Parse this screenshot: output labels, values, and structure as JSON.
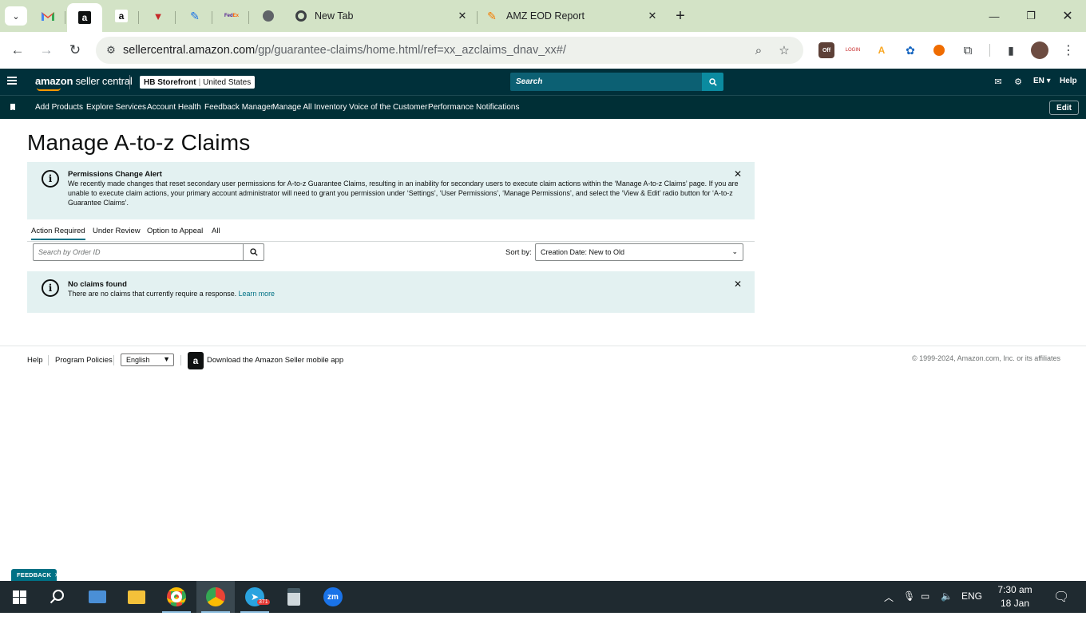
{
  "browser": {
    "tabs": [
      {
        "label": "New Tab",
        "icon": "chrome-icon"
      },
      {
        "label": "AMZ EOD Report",
        "icon": "sheets-icon"
      }
    ],
    "url_host": "sellercentral.amazon.com",
    "url_path": "/gp/guarantee-claims/home.html/ref=xx_azclaims_dnav_xx#/",
    "extensions": [
      "coupon-off-icon",
      "login-icon",
      "scout-icon",
      "extension-blue-icon",
      "extension-orange-icon",
      "puzzle-icon"
    ]
  },
  "header": {
    "logo_brand": "amazon",
    "logo_product": "seller central",
    "store_name": "HB Storefront",
    "store_region": "United States",
    "search_placeholder": "Search",
    "language": "EN",
    "help": "Help"
  },
  "subnav": {
    "items": [
      "Add Products",
      "Explore Services",
      "Account Health",
      "Feedback Manager",
      "Manage All Inventory",
      "Voice of the Customer",
      "Performance Notifications"
    ],
    "edit": "Edit"
  },
  "page": {
    "title": "Manage A-to-z Claims",
    "permissions_alert": {
      "title": "Permissions Change Alert",
      "body": "We recently made changes that reset secondary user permissions for A-to-z Guarantee Claims, resulting in an inability for secondary users to execute claim actions within the ‘Manage A-to-z Claims’ page. If you are unable to execute claim actions, your primary account administrator will need to grant you permission under ‘Settings’, ‘User Permissions’, ‘Manage Permissions’, and select the ‘View & Edit’ radio button for ‘A-to-z Guarantee Claims’."
    },
    "tabs": [
      "Action Required",
      "Under Review",
      "Option to Appeal",
      "All"
    ],
    "active_tab": "Action Required",
    "search_placeholder": "Search by Order ID",
    "sort_label": "Sort by:",
    "sort_value": "Creation Date: New to Old",
    "no_claims": {
      "title": "No claims found",
      "body": "There are no claims that currently require a response.",
      "link": "Learn more"
    }
  },
  "footer": {
    "help": "Help",
    "program_policies": "Program Policies",
    "language": "English",
    "app_download": "Download the Amazon Seller mobile app",
    "copyright": "© 1999-2024, Amazon.com, Inc. or its affiliates"
  },
  "feedback": "FEEDBACK",
  "taskbar": {
    "telegram_badge": "371",
    "zoom_label": "zm",
    "language": "ENG",
    "time": "7:30 am",
    "date": "18 Jan 2024"
  },
  "colors": {
    "browser_tabbar": "#d3e3c6",
    "amazon_header": "#00303a",
    "alert_bg": "#e3f1f1",
    "link": "#007185"
  }
}
